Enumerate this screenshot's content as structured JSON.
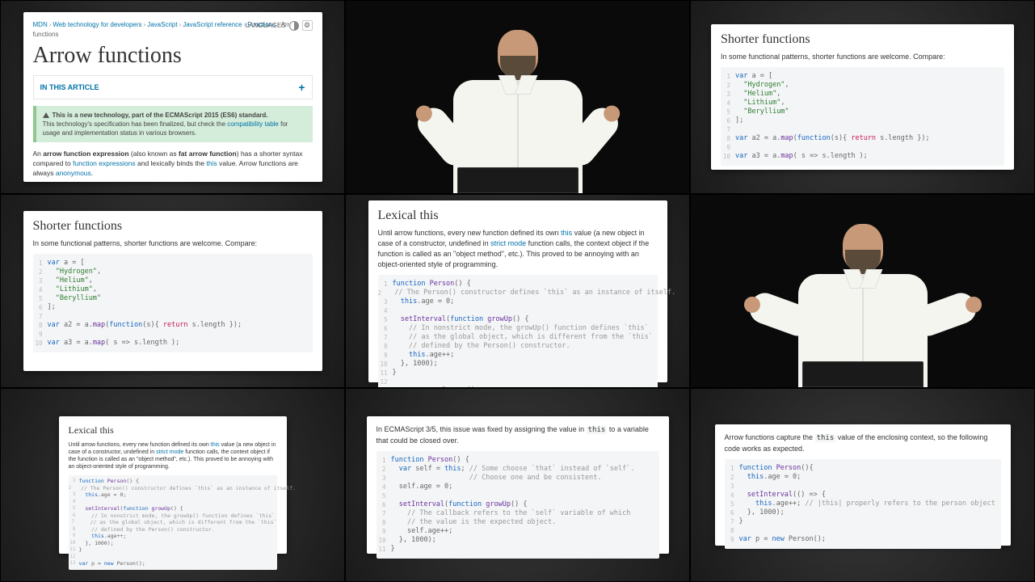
{
  "cell1": {
    "breadcrumb": [
      "MDN",
      "Web technology for developers",
      "JavaScript",
      "JavaScript reference",
      "Functions",
      "Arrow functions"
    ],
    "lang_label": "LANGUAGES",
    "title": "Arrow functions",
    "toc": "IN THIS ARTICLE",
    "note_bold": "This is a new technology, part of the ECMAScript 2015 (ES6) standard.",
    "note_rest_a": "This technology's specification has been finalized, but check the ",
    "note_link": "compatibility table",
    "note_rest_b": " for usage and implementation status in various browsers.",
    "intro_a": "An ",
    "intro_b1": "arrow function expression",
    "intro_c": " (also known as ",
    "intro_b2": "fat arrow function",
    "intro_d": ") has a shorter syntax compared to ",
    "intro_link1": "function expressions",
    "intro_e": " and lexically binds the ",
    "intro_link2": "this",
    "intro_f": " value. Arrow functions are always ",
    "intro_link3": "anonymous",
    "intro_g": "."
  },
  "shorter": {
    "title": "Shorter functions",
    "p": "In some functional patterns, shorter functions are welcome. Compare:",
    "lines": [
      {
        "n": "1",
        "html": "<span class='kw'>var</span> a = ["
      },
      {
        "n": "2",
        "html": "  <span class='str'>\"Hydrogen\"</span>,"
      },
      {
        "n": "3",
        "html": "  <span class='str'>\"Helium\"</span>,"
      },
      {
        "n": "4",
        "html": "  <span class='str'>\"Lithium\"</span>,"
      },
      {
        "n": "5",
        "html": "  <span class='str'>\"Beryllium\"</span>"
      },
      {
        "n": "6",
        "html": "];"
      },
      {
        "n": "7",
        "html": ""
      },
      {
        "n": "8",
        "html": "<span class='kw'>var</span> a2 = a.<span class='fn'>map</span>(<span class='kw'>function</span>(s){ <span class='ret'>return</span> s.length });"
      },
      {
        "n": "9",
        "html": ""
      },
      {
        "n": "10",
        "html": "<span class='kw'>var</span> a3 = a.<span class='fn'>map</span>( s =&gt; s.length );"
      }
    ]
  },
  "lexical": {
    "title": "Lexical this",
    "p_a": "Until arrow functions, every new function defined its own ",
    "p_link1": "this",
    "p_b": " value (a new object in case of a constructor, undefined in ",
    "p_link2": "strict mode",
    "p_c": " function calls, the context object if the function is called as an \"object method\", etc.). This proved to be annoying with an object-oriented style of programming.",
    "lines": [
      {
        "n": "1",
        "html": "<span class='kw'>function</span> <span class='fn'>Person</span>() {"
      },
      {
        "n": "2",
        "html": "  <span class='com'>// The Person() constructor defines `this` as an instance of itself.</span>"
      },
      {
        "n": "3",
        "html": "  <span class='kw'>this</span>.age = 0;"
      },
      {
        "n": "4",
        "html": ""
      },
      {
        "n": "5",
        "html": "  <span class='fn'>setInterval</span>(<span class='kw'>function</span> <span class='fn'>growUp</span>() {"
      },
      {
        "n": "6",
        "html": "    <span class='com'>// In nonstrict mode, the growUp() function defines `this`</span>"
      },
      {
        "n": "7",
        "html": "    <span class='com'>// as the global object, which is different from the `this`</span>"
      },
      {
        "n": "8",
        "html": "    <span class='com'>// defined by the Person() constructor.</span>"
      },
      {
        "n": "9",
        "html": "    <span class='kw'>this</span>.age++;"
      },
      {
        "n": "10",
        "html": "  }, 1000);"
      },
      {
        "n": "11",
        "html": "}"
      },
      {
        "n": "12",
        "html": ""
      },
      {
        "n": "13",
        "html": "<span class='kw'>var</span> p = <span class='new'>new</span> Person();"
      }
    ]
  },
  "ecma35": {
    "p_a": "In ECMAScript 3/5, this issue was fixed by assigning the value in ",
    "p_code": "this",
    "p_b": " to a variable that could be closed over.",
    "lines": [
      {
        "n": "1",
        "html": "<span class='kw'>function</span> <span class='fn'>Person</span>() {"
      },
      {
        "n": "2",
        "html": "  <span class='kw'>var</span> self = <span class='kw'>this</span>; <span class='com'>// Some choose `that` instead of `self`.</span>"
      },
      {
        "n": "3",
        "html": "                   <span class='com'>// Choose one and be consistent.</span>"
      },
      {
        "n": "4",
        "html": "  self.age = 0;"
      },
      {
        "n": "5",
        "html": ""
      },
      {
        "n": "6",
        "html": "  <span class='fn'>setInterval</span>(<span class='kw'>function</span> <span class='fn'>growUp</span>() {"
      },
      {
        "n": "7",
        "html": "    <span class='com'>// The callback refers to the `self` variable of which</span>"
      },
      {
        "n": "8",
        "html": "    <span class='com'>// the value is the expected object.</span>"
      },
      {
        "n": "9",
        "html": "    self.age++;"
      },
      {
        "n": "10",
        "html": "  }, 1000);"
      },
      {
        "n": "11",
        "html": "}"
      }
    ]
  },
  "capture": {
    "p_a": "Arrow functions capture the ",
    "p_code": "this",
    "p_b": " value of the enclosing context, so the following code works as expected.",
    "lines": [
      {
        "n": "1",
        "html": "<span class='kw'>function</span> <span class='fn'>Person</span>(){"
      },
      {
        "n": "2",
        "html": "  <span class='kw'>this</span>.age = 0;"
      },
      {
        "n": "3",
        "html": ""
      },
      {
        "n": "4",
        "html": "  <span class='fn'>setInterval</span>(() =&gt; {"
      },
      {
        "n": "5",
        "html": "    <span class='kw'>this</span>.age++; <span class='com'>// |this| properly refers to the person object</span>"
      },
      {
        "n": "6",
        "html": "  }, 1000);"
      },
      {
        "n": "7",
        "html": "}"
      },
      {
        "n": "8",
        "html": ""
      },
      {
        "n": "9",
        "html": "<span class='kw'>var</span> p = <span class='new'>new</span> Person();"
      }
    ]
  }
}
